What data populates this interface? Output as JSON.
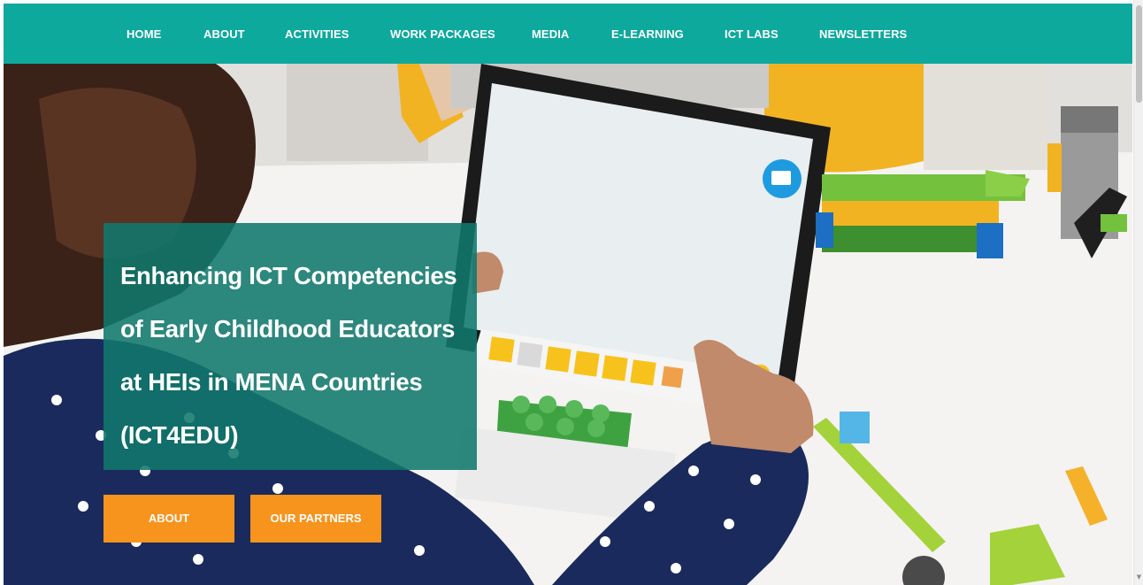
{
  "nav": {
    "items": [
      {
        "label": "HOME"
      },
      {
        "label": "ABOUT"
      },
      {
        "label": "ACTIVITIES"
      },
      {
        "label": "WORK PACKAGES"
      },
      {
        "label": "MEDIA"
      },
      {
        "label": "E-LEARNING"
      },
      {
        "label": "ICT LABS"
      },
      {
        "label": "NEWSLETTERS"
      }
    ]
  },
  "hero": {
    "title_lines": [
      "Enhancing ICT Competencies",
      "of Early Childhood Educators",
      "at HEIs in MENA Countries",
      "(ICT4EDU)"
    ],
    "buttons": {
      "about": "ABOUT",
      "partners": "OUR PARTNERS"
    }
  },
  "colors": {
    "nav_bg": "#0ea99d",
    "title_box_bg": "#10786c",
    "button_bg": "#f7941d",
    "text": "#ffffff"
  },
  "icons": {
    "scroll_up": "scroll-up-arrow-icon",
    "scroll_down": "scroll-down-arrow-icon"
  }
}
